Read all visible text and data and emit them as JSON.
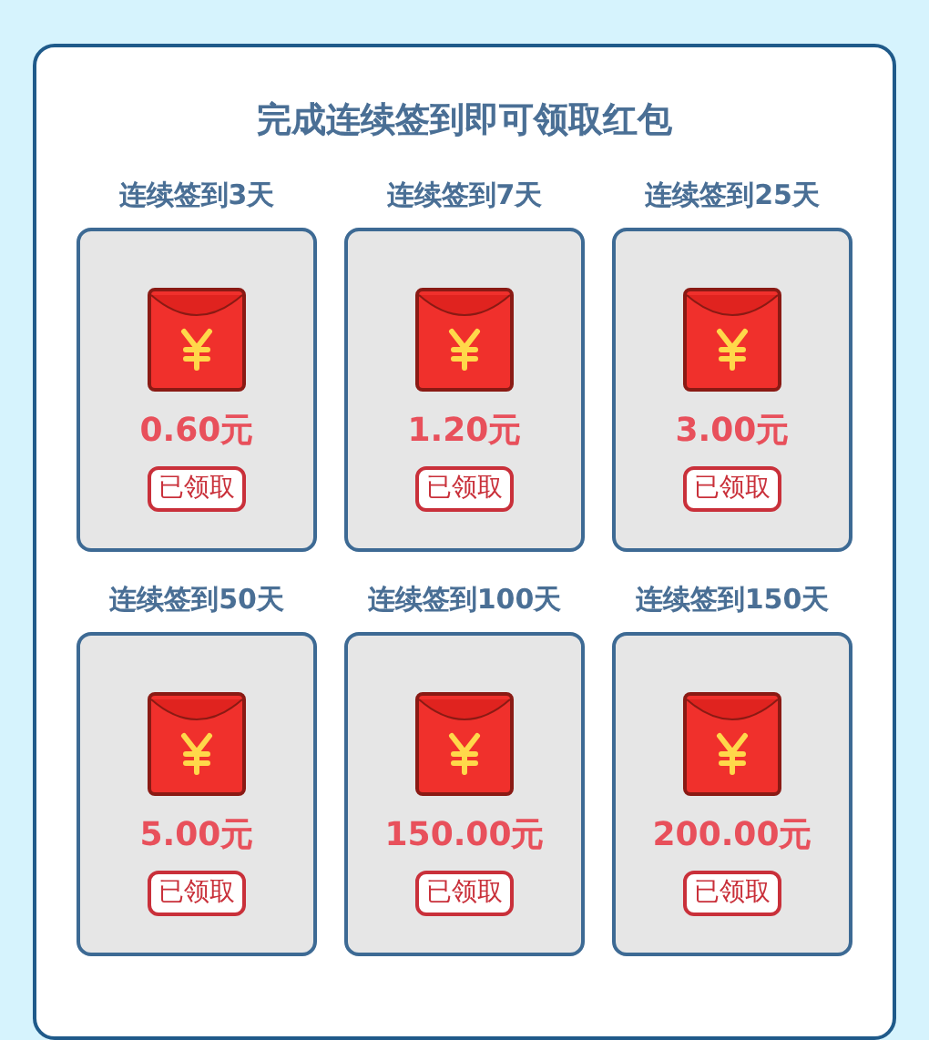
{
  "title": "完成连续签到即可领取红包",
  "rewards": [
    {
      "label": "连续签到3天",
      "amount": "0.60元",
      "button": "已领取",
      "claimed": true
    },
    {
      "label": "连续签到7天",
      "amount": "1.20元",
      "button": "已领取",
      "claimed": true
    },
    {
      "label": "连续签到25天",
      "amount": "3.00元",
      "button": "已领取",
      "claimed": true
    },
    {
      "label": "连续签到50天",
      "amount": "5.00元",
      "button": "已领取",
      "claimed": true
    },
    {
      "label": "连续签到100天",
      "amount": "150.00元",
      "button": "已领取",
      "claimed": true
    },
    {
      "label": "连续签到150天",
      "amount": "200.00元",
      "button": "已领取",
      "claimed": true
    }
  ]
}
